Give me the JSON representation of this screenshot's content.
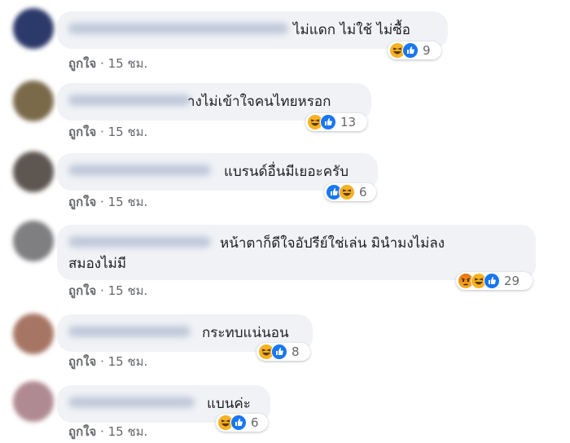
{
  "meta": {
    "like_label": "ถูกใจ",
    "sep": "·",
    "time": "15 ชม."
  },
  "colors": {
    "bubble": "#f0f2f5",
    "meta_text": "#65676b",
    "like_blue": "#1877f2",
    "haha_yellow": "#f7b125",
    "angry_orange": "#e9710f"
  },
  "comments": [
    {
      "text": "ไม่แดก ไม่ใช้ ไม่ซื้อ",
      "reactions": [
        "haha-icon",
        "like-icon"
      ],
      "count": "9"
    },
    {
      "text": "างไม่เข้าใจคนไทยหรอก",
      "reactions": [
        "haha-icon",
        "like-icon"
      ],
      "count": "13"
    },
    {
      "text": "แบรนด์อื่นมีเยอะครับ",
      "reactions": [
        "like-icon",
        "haha-icon"
      ],
      "count": "6"
    },
    {
      "text": "หน้าตาก็ดีใจอัปรีย์ใช่เล่น มินำมงไม่ลง",
      "text2": "สมองไม่มี",
      "reactions": [
        "angry-icon",
        "haha-icon",
        "like-icon"
      ],
      "count": "29"
    },
    {
      "text": "กระทบแน่นอน",
      "reactions": [
        "haha-icon",
        "like-icon"
      ],
      "count": "8"
    },
    {
      "text": "แบนค่ะ",
      "reactions": [
        "haha-icon",
        "like-icon"
      ],
      "count": "6"
    }
  ]
}
